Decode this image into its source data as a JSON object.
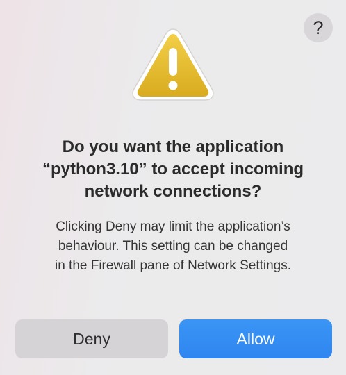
{
  "dialog": {
    "help_label": "?",
    "icon": "warning-triangle-icon",
    "title_lines": [
      "Do you want the application",
      "“python3.10” to accept incoming",
      "network connections?"
    ],
    "message_lines": [
      "Clicking Deny may limit the application’s",
      "behaviour. This setting can be changed",
      "in the Firewall pane of Network Settings."
    ],
    "buttons": {
      "deny_label": "Deny",
      "allow_label": "Allow"
    }
  },
  "colors": {
    "accent": "#2f86f0",
    "warning_fill": "#e3b72c"
  }
}
